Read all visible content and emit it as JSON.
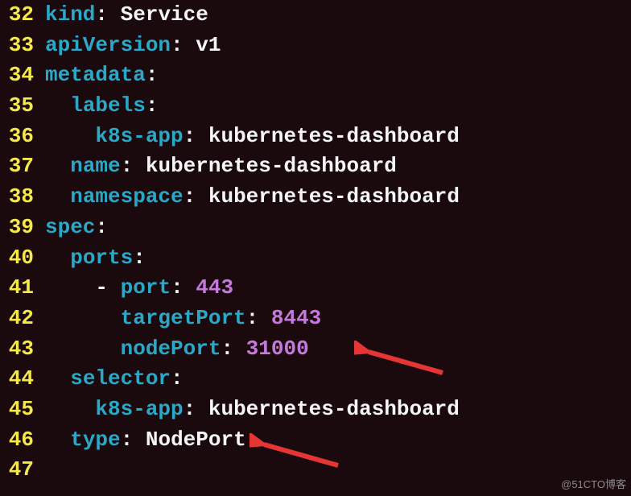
{
  "lines": [
    {
      "num": "32",
      "indent": "",
      "key": "kind",
      "sep": ": ",
      "val": "Service",
      "valClass": "val"
    },
    {
      "num": "33",
      "indent": "",
      "key": "apiVersion",
      "sep": ": ",
      "val": "v1",
      "valClass": "val"
    },
    {
      "num": "34",
      "indent": "",
      "key": "metadata",
      "sep": ":",
      "val": "",
      "valClass": "val"
    },
    {
      "num": "35",
      "indent": "  ",
      "key": "labels",
      "sep": ":",
      "val": "",
      "valClass": "val"
    },
    {
      "num": "36",
      "indent": "    ",
      "key": "k8s-app",
      "sep": ": ",
      "val": "kubernetes-dashboard",
      "valClass": "val"
    },
    {
      "num": "37",
      "indent": "  ",
      "key": "name",
      "sep": ": ",
      "val": "kubernetes-dashboard",
      "valClass": "val"
    },
    {
      "num": "38",
      "indent": "  ",
      "key": "namespace",
      "sep": ": ",
      "val": "kubernetes-dashboard",
      "valClass": "val"
    },
    {
      "num": "39",
      "indent": "",
      "key": "spec",
      "sep": ":",
      "val": "",
      "valClass": "val"
    },
    {
      "num": "40",
      "indent": "  ",
      "key": "ports",
      "sep": ":",
      "val": "",
      "valClass": "val"
    },
    {
      "num": "41",
      "indent": "    ",
      "dash": "- ",
      "key": "port",
      "sep": ": ",
      "val": "443",
      "valClass": "num"
    },
    {
      "num": "42",
      "indent": "      ",
      "key": "targetPort",
      "sep": ": ",
      "val": "8443",
      "valClass": "num"
    },
    {
      "num": "43",
      "indent": "      ",
      "key": "nodePort",
      "sep": ": ",
      "val": "31000",
      "valClass": "num"
    },
    {
      "num": "44",
      "indent": "  ",
      "key": "selector",
      "sep": ":",
      "val": "",
      "valClass": "val"
    },
    {
      "num": "45",
      "indent": "    ",
      "key": "k8s-app",
      "sep": ": ",
      "val": "kubernetes-dashboard",
      "valClass": "val"
    },
    {
      "num": "46",
      "indent": "  ",
      "key": "type",
      "sep": ": ",
      "val": "NodePort",
      "valClass": "val"
    },
    {
      "num": "47",
      "indent": "",
      "key": "",
      "sep": "",
      "val": "",
      "valClass": "val"
    }
  ],
  "watermark": "@51CTO博客"
}
